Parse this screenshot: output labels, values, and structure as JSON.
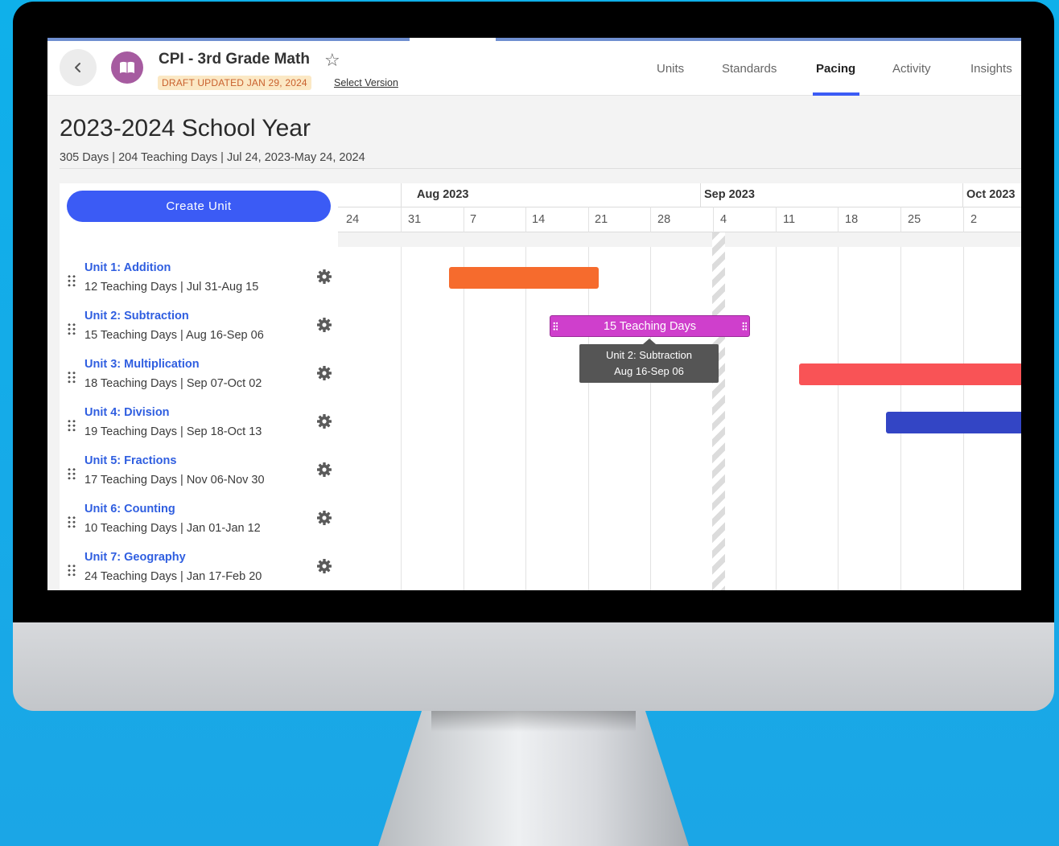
{
  "header": {
    "course_title": "CPI - 3rd Grade Math",
    "draft_badge": "DRAFT UPDATED JAN 29, 2024",
    "select_version": "Select Version",
    "tabs": [
      {
        "label": "Units",
        "active": false
      },
      {
        "label": "Standards",
        "active": false
      },
      {
        "label": "Pacing",
        "active": true
      },
      {
        "label": "Activity",
        "active": false
      },
      {
        "label": "Insights",
        "active": false
      }
    ]
  },
  "school_year": {
    "title": "2023-2024 School Year",
    "summary": "305 Days | 204 Teaching Days | Jul 24, 2023-May 24, 2024"
  },
  "sidebar": {
    "create_unit_label": "Create Unit",
    "units": [
      {
        "name": "Unit 1: Addition",
        "meta": "12 Teaching Days | Jul 31-Aug 15",
        "color": "#f66b2d"
      },
      {
        "name": "Unit 2: Subtraction",
        "meta": "15 Teaching Days | Aug 16-Sep 06",
        "color": "#cf3fcc"
      },
      {
        "name": "Unit 3: Multiplication",
        "meta": "18 Teaching Days | Sep 07-Oct 02",
        "color": "#f95356"
      },
      {
        "name": "Unit 4: Division",
        "meta": "19 Teaching Days | Sep 18-Oct 13",
        "color": "#3345c5"
      },
      {
        "name": "Unit 5: Fractions",
        "meta": "17 Teaching Days | Nov 06-Nov 30"
      },
      {
        "name": "Unit 6: Counting",
        "meta": "10 Teaching Days | Jan 01-Jan 12"
      },
      {
        "name": "Unit 7: Geography",
        "meta": "24 Teaching Days | Jan 17-Feb 20"
      }
    ]
  },
  "timeline": {
    "months": [
      "Aug 2023",
      "Sep 2023",
      "Oct 2023"
    ],
    "weeks": [
      "24",
      "31",
      "7",
      "14",
      "21",
      "28",
      "4",
      "11",
      "18",
      "25",
      "2"
    ],
    "selected_bar_label": "15 Teaching Days",
    "tooltip": {
      "title": "Unit 2: Subtraction",
      "dates": "Aug 16-Sep 06"
    }
  },
  "colors": {
    "accent": "#3b5bf5",
    "unit_link": "#2f5ee0",
    "book_icon": "#a65ba0"
  }
}
